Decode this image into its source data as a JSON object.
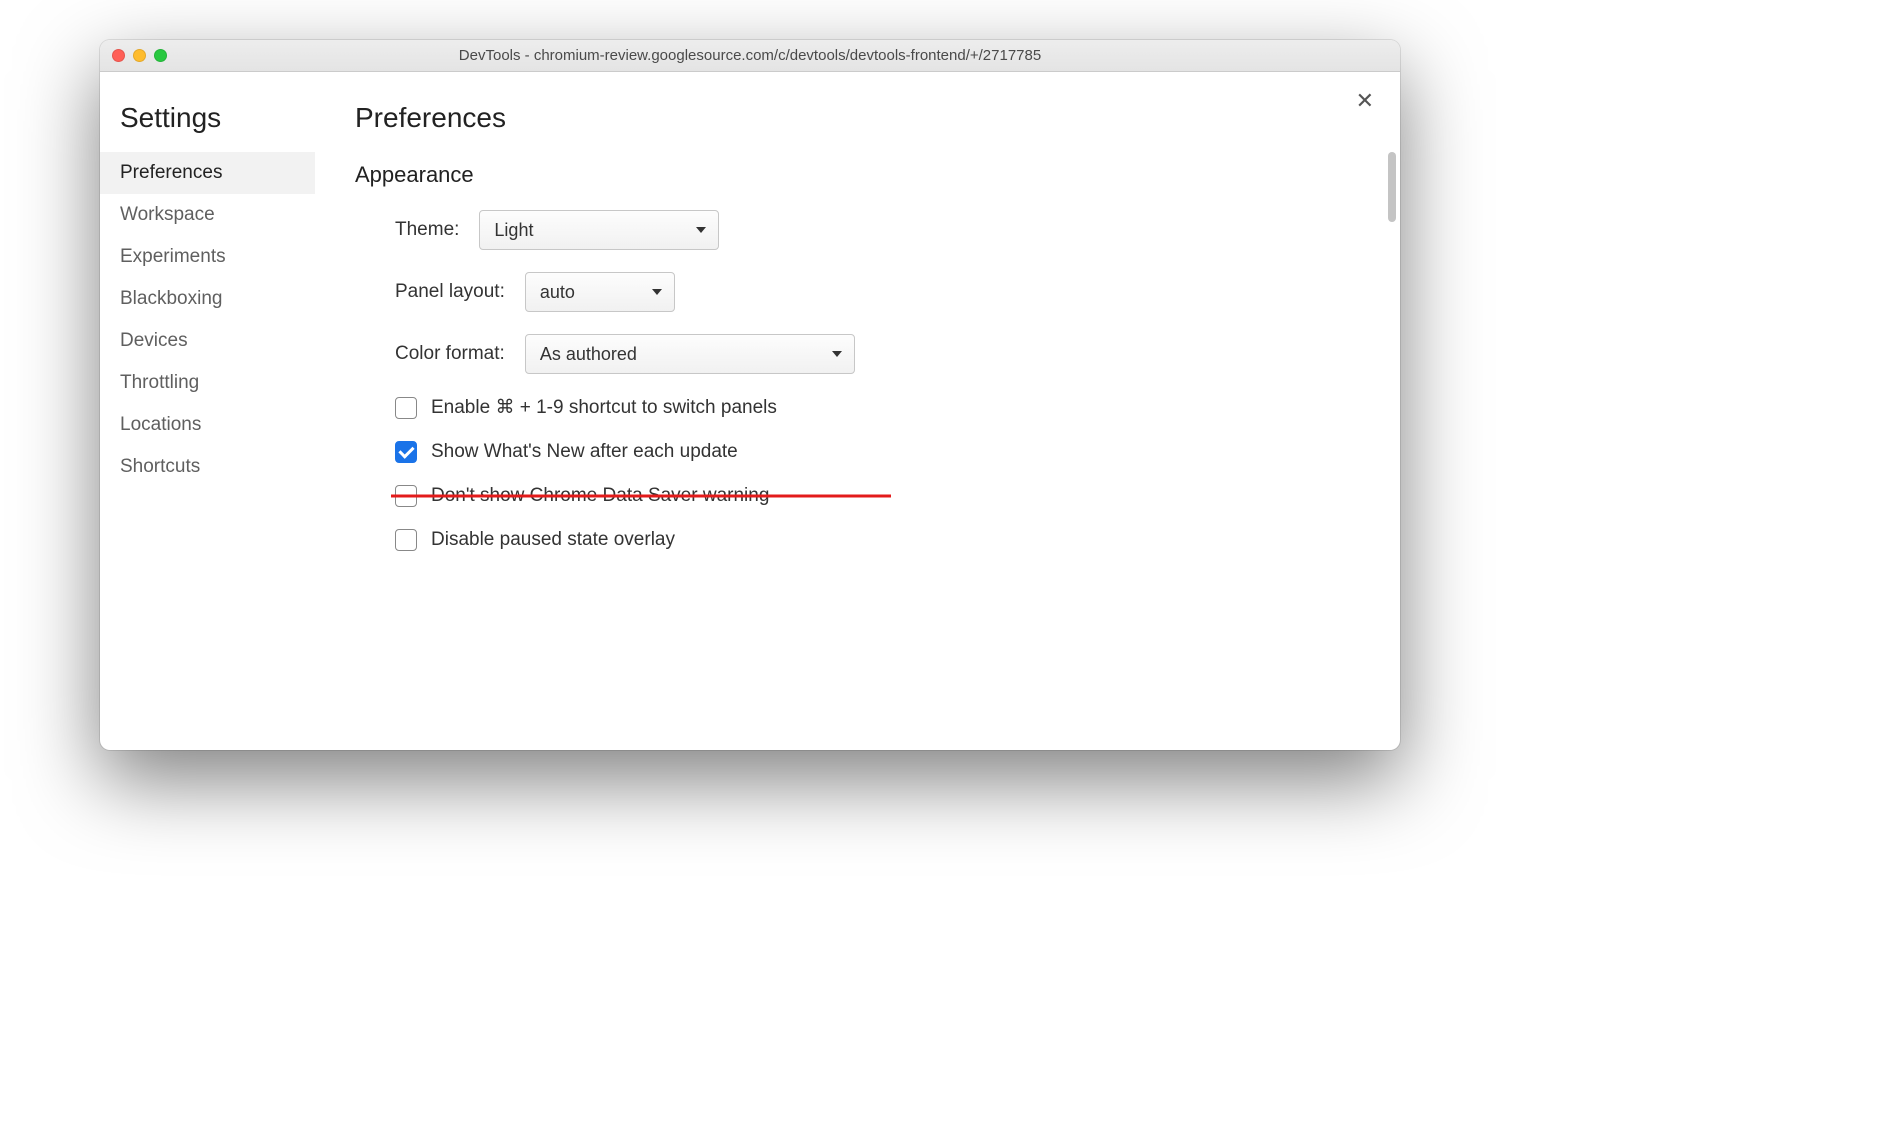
{
  "window": {
    "title": "DevTools - chromium-review.googlesource.com/c/devtools/devtools-frontend/+/2717785"
  },
  "sidebar": {
    "heading": "Settings",
    "items": [
      {
        "label": "Preferences",
        "active": true
      },
      {
        "label": "Workspace",
        "active": false
      },
      {
        "label": "Experiments",
        "active": false
      },
      {
        "label": "Blackboxing",
        "active": false
      },
      {
        "label": "Devices",
        "active": false
      },
      {
        "label": "Throttling",
        "active": false
      },
      {
        "label": "Locations",
        "active": false
      },
      {
        "label": "Shortcuts",
        "active": false
      }
    ]
  },
  "main": {
    "heading": "Preferences",
    "section": "Appearance",
    "theme": {
      "label": "Theme:",
      "value": "Light"
    },
    "panel_layout": {
      "label": "Panel layout:",
      "value": "auto"
    },
    "color_format": {
      "label": "Color format:",
      "value": "As authored"
    },
    "options": [
      {
        "label": "Enable ⌘ + 1-9 shortcut to switch panels",
        "checked": false,
        "struck": false
      },
      {
        "label": "Show What's New after each update",
        "checked": true,
        "struck": false
      },
      {
        "label": "Don't show Chrome Data Saver warning",
        "checked": false,
        "struck": true
      },
      {
        "label": "Disable paused state overlay",
        "checked": false,
        "struck": false
      }
    ]
  },
  "close_glyph": "✕"
}
